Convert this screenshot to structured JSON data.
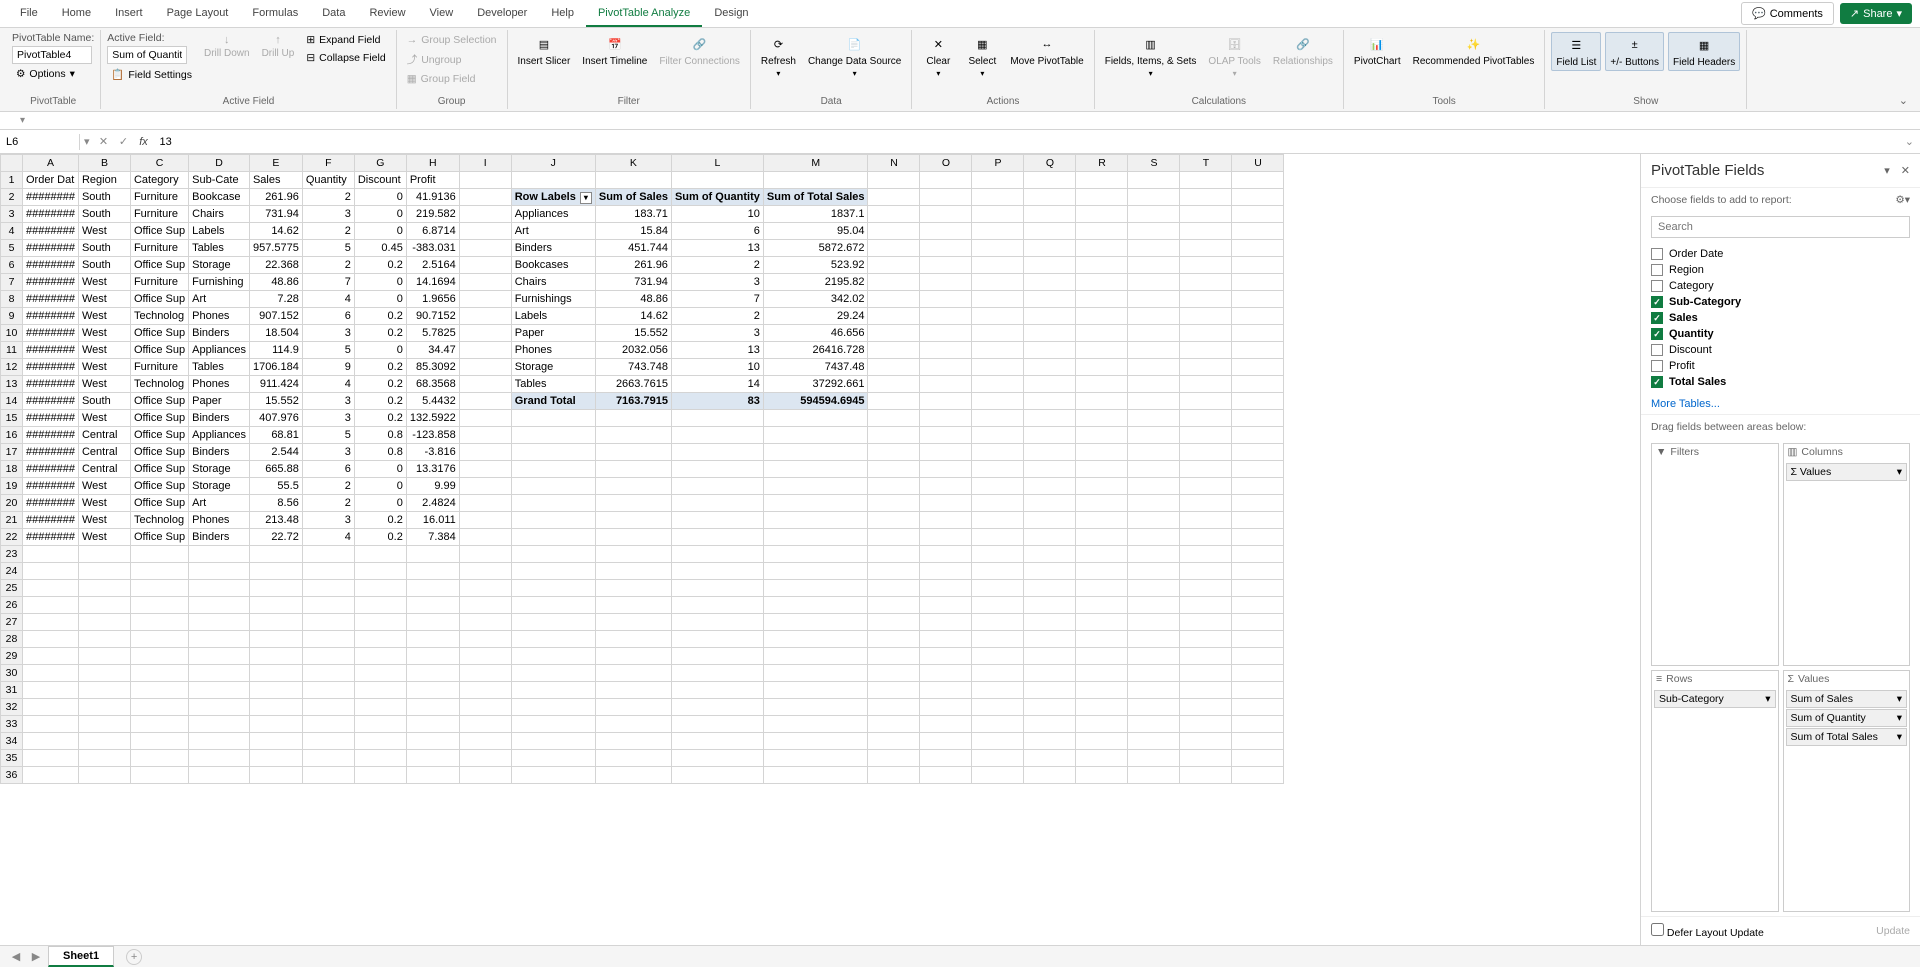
{
  "tabs": [
    "File",
    "Home",
    "Insert",
    "Page Layout",
    "Formulas",
    "Data",
    "Review",
    "View",
    "Developer",
    "Help",
    "PivotTable Analyze",
    "Design"
  ],
  "active_tab": "PivotTable Analyze",
  "top_right": {
    "comments": "Comments",
    "share": "Share"
  },
  "ribbon": {
    "pt_name_label": "PivotTable Name:",
    "pt_name_value": "PivotTable4",
    "options": "Options",
    "active_field_label": "Active Field:",
    "active_field_value": "Sum of Quantity",
    "field_settings": "Field Settings",
    "drill_down": "Drill Down",
    "drill_up": "Drill Up",
    "expand": "Expand Field",
    "collapse": "Collapse Field",
    "group_selection": "Group Selection",
    "ungroup": "Ungroup",
    "group_field": "Group Field",
    "insert_slicer": "Insert Slicer",
    "insert_timeline": "Insert Timeline",
    "filter_connections": "Filter Connections",
    "refresh": "Refresh",
    "change_ds": "Change Data Source",
    "clear": "Clear",
    "select": "Select",
    "move_pt": "Move PivotTable",
    "fields_items": "Fields, Items, & Sets",
    "olap": "OLAP Tools",
    "relationships": "Relationships",
    "pivotchart": "PivotChart",
    "recommended": "Recommended PivotTables",
    "field_list": "Field List",
    "pm_buttons": "+/- Buttons",
    "field_headers": "Field Headers",
    "groups": {
      "pt": "PivotTable",
      "af": "Active Field",
      "grp": "Group",
      "flt": "Filter",
      "dat": "Data",
      "act": "Actions",
      "calc": "Calculations",
      "tls": "Tools",
      "show": "Show"
    }
  },
  "name_box": "L6",
  "formula_value": "13",
  "col_headers": [
    "A",
    "B",
    "C",
    "D",
    "E",
    "F",
    "G",
    "H",
    "I",
    "J",
    "K",
    "L",
    "M",
    "N",
    "O",
    "P",
    "Q",
    "R",
    "S",
    "T",
    "U"
  ],
  "data_headers": [
    "Order Dat",
    "Region",
    "Category",
    "Sub-Cate",
    "Sales",
    "Quantity",
    "Discount",
    "Profit"
  ],
  "data_rows": [
    [
      "########",
      "South",
      "Furniture",
      "Bookcase",
      261.96,
      2,
      0,
      41.9136
    ],
    [
      "########",
      "South",
      "Furniture",
      "Chairs",
      731.94,
      3,
      0,
      219.582
    ],
    [
      "########",
      "West",
      "Office Sup",
      "Labels",
      14.62,
      2,
      0,
      6.8714
    ],
    [
      "########",
      "South",
      "Furniture",
      "Tables",
      "957.5775",
      5,
      0.45,
      -383.031
    ],
    [
      "########",
      "South",
      "Office Sup",
      "Storage",
      22.368,
      2,
      0.2,
      2.5164
    ],
    [
      "########",
      "West",
      "Furniture",
      "Furnishing",
      48.86,
      7,
      0,
      14.1694
    ],
    [
      "########",
      "West",
      "Office Sup",
      "Art",
      7.28,
      4,
      0,
      1.9656
    ],
    [
      "########",
      "West",
      "Technolog",
      "Phones",
      907.152,
      6,
      0.2,
      90.7152
    ],
    [
      "########",
      "West",
      "Office Sup",
      "Binders",
      18.504,
      3,
      0.2,
      5.7825
    ],
    [
      "########",
      "West",
      "Office Sup",
      "Appliances",
      114.9,
      5,
      0,
      34.47
    ],
    [
      "########",
      "West",
      "Furniture",
      "Tables",
      1706.184,
      9,
      0.2,
      85.3092
    ],
    [
      "########",
      "West",
      "Technolog",
      "Phones",
      911.424,
      4,
      0.2,
      68.3568
    ],
    [
      "########",
      "South",
      "Office Sup",
      "Paper",
      15.552,
      3,
      0.2,
      5.4432
    ],
    [
      "########",
      "West",
      "Office Sup",
      "Binders",
      407.976,
      3,
      0.2,
      132.5922
    ],
    [
      "########",
      "Central",
      "Office Sup",
      "Appliances",
      68.81,
      5,
      0.8,
      -123.858
    ],
    [
      "########",
      "Central",
      "Office Sup",
      "Binders",
      2.544,
      3,
      0.8,
      -3.816
    ],
    [
      "########",
      "Central",
      "Office Sup",
      "Storage",
      665.88,
      6,
      0,
      13.3176
    ],
    [
      "########",
      "West",
      "Office Sup",
      "Storage",
      55.5,
      2,
      0,
      9.99
    ],
    [
      "########",
      "West",
      "Office Sup",
      "Art",
      8.56,
      2,
      0,
      2.4824
    ],
    [
      "########",
      "West",
      "Technolog",
      "Phones",
      213.48,
      3,
      0.2,
      16.011
    ],
    [
      "########",
      "West",
      "Office Sup",
      "Binders",
      22.72,
      4,
      0.2,
      7.384
    ]
  ],
  "pivot_headers": {
    "row_labels": "Row Labels",
    "sum_sales": "Sum of Sales",
    "sum_qty": "Sum of Quantity",
    "sum_total": "Sum of Total Sales"
  },
  "pivot_rows": [
    [
      "Appliances",
      183.71,
      10,
      1837.1
    ],
    [
      "Art",
      15.84,
      6,
      95.04
    ],
    [
      "Binders",
      451.744,
      13,
      5872.672
    ],
    [
      "Bookcases",
      261.96,
      2,
      523.92
    ],
    [
      "Chairs",
      731.94,
      3,
      2195.82
    ],
    [
      "Furnishings",
      48.86,
      7,
      342.02
    ],
    [
      "Labels",
      14.62,
      2,
      29.24
    ],
    [
      "Paper",
      15.552,
      3,
      46.656
    ],
    [
      "Phones",
      2032.056,
      13,
      26416.728
    ],
    [
      "Storage",
      743.748,
      10,
      7437.48
    ],
    [
      "Tables",
      "2663.7615",
      14,
      37292.661
    ]
  ],
  "pivot_total": [
    "Grand Total",
    "7163.7915",
    83,
    "594594.6945"
  ],
  "field_pane": {
    "title": "PivotTable Fields",
    "choose_label": "Choose fields to add to report:",
    "search_placeholder": "Search",
    "fields": [
      {
        "name": "Order Date",
        "checked": false
      },
      {
        "name": "Region",
        "checked": false
      },
      {
        "name": "Category",
        "checked": false
      },
      {
        "name": "Sub-Category",
        "checked": true
      },
      {
        "name": "Sales",
        "checked": true
      },
      {
        "name": "Quantity",
        "checked": true
      },
      {
        "name": "Discount",
        "checked": false
      },
      {
        "name": "Profit",
        "checked": false
      },
      {
        "name": "Total Sales",
        "checked": true
      }
    ],
    "more_tables": "More Tables...",
    "drag_label": "Drag fields between areas below:",
    "areas": {
      "filters": "Filters",
      "columns": "Columns",
      "rows": "Rows",
      "values": "Values"
    },
    "columns_items": [
      "Σ Values"
    ],
    "rows_items": [
      "Sub-Category"
    ],
    "values_items": [
      "Sum of Sales",
      "Sum of Quantity",
      "Sum of Total Sales"
    ],
    "defer": "Defer Layout Update",
    "update": "Update"
  },
  "sheet_name": "Sheet1"
}
